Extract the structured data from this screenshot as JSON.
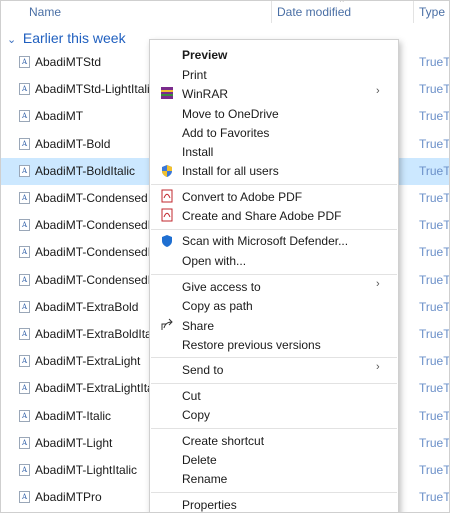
{
  "header": {
    "name": "Name",
    "date_modified": "Date modified",
    "type": "Type"
  },
  "group": {
    "label": "Earlier this week"
  },
  "files": [
    {
      "name": "AbadiMTStd",
      "type": "TrueT"
    },
    {
      "name": "AbadiMTStd-LightItalic",
      "type": "TrueT"
    },
    {
      "name": "AbadiMT",
      "type": "TrueT"
    },
    {
      "name": "AbadiMT-Bold",
      "type": "TrueT"
    },
    {
      "name": "AbadiMT-BoldItalic",
      "type": "TrueT",
      "selected": true
    },
    {
      "name": "AbadiMT-Condensed",
      "type": "TrueT"
    },
    {
      "name": "AbadiMT-CondensedBo",
      "type": "TrueT"
    },
    {
      "name": "AbadiMT-CondensedExt",
      "type": "TrueT"
    },
    {
      "name": "AbadiMT-CondensedLig",
      "type": "TrueT"
    },
    {
      "name": "AbadiMT-ExtraBold",
      "type": "TrueT"
    },
    {
      "name": "AbadiMT-ExtraBoldItalic",
      "type": "TrueT"
    },
    {
      "name": "AbadiMT-ExtraLight",
      "type": "TrueT"
    },
    {
      "name": "AbadiMT-ExtraLightItalic",
      "type": "TrueT"
    },
    {
      "name": "AbadiMT-Italic",
      "type": "TrueT"
    },
    {
      "name": "AbadiMT-Light",
      "type": "TrueT"
    },
    {
      "name": "AbadiMT-LightItalic",
      "type": "TrueT"
    },
    {
      "name": "AbadiMTPro",
      "type": "TrueT"
    }
  ],
  "file_icon_glyph": "A",
  "menu": {
    "preview": "Preview",
    "print": "Print",
    "winrar": "WinRAR",
    "move_onedrive": "Move to OneDrive",
    "add_favorites": "Add to Favorites",
    "install": "Install",
    "install_all_users": "Install for all users",
    "convert_pdf": "Convert to Adobe PDF",
    "create_share_pdf": "Create and Share Adobe PDF",
    "scan_defender": "Scan with Microsoft Defender...",
    "open_with": "Open with...",
    "give_access": "Give access to",
    "copy_path": "Copy as path",
    "share": "Share",
    "restore_versions": "Restore previous versions",
    "send_to": "Send to",
    "cut": "Cut",
    "copy": "Copy",
    "create_shortcut": "Create shortcut",
    "delete": "Delete",
    "rename": "Rename",
    "properties": "Properties",
    "submenu_arrow": "›"
  },
  "colors": {
    "selection": "#cce8ff",
    "highlight_box": "#e0151a",
    "group_text": "#1f5fbf"
  }
}
